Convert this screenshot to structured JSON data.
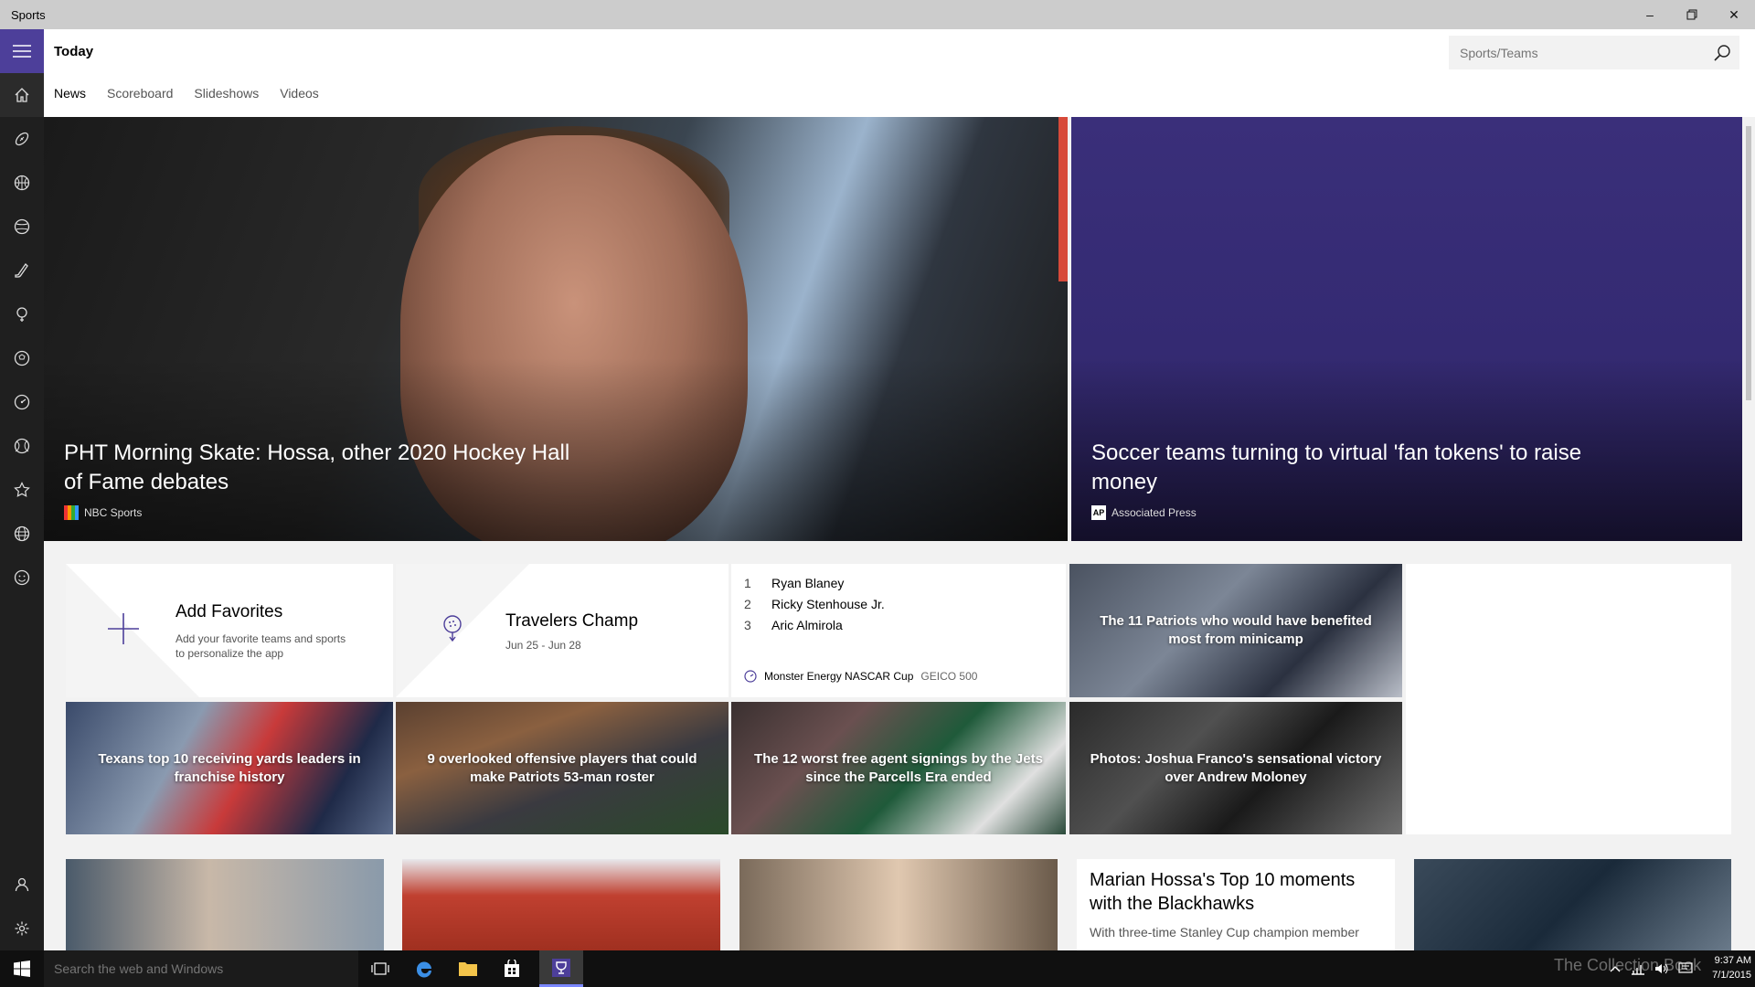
{
  "window": {
    "title": "Sports"
  },
  "header": {
    "title": "Today",
    "search": {
      "placeholder": "Sports/Teams",
      "value": ""
    },
    "tabs": [
      {
        "label": "News",
        "active": true
      },
      {
        "label": "Scoreboard",
        "active": false
      },
      {
        "label": "Slideshows",
        "active": false
      },
      {
        "label": "Videos",
        "active": false
      }
    ]
  },
  "rail": {
    "icons": [
      "hamburger-icon",
      "home-icon",
      "football-icon",
      "basketball-icon",
      "baseball-icon",
      "hockey-icon",
      "golf-icon",
      "soccer-icon",
      "racing-icon",
      "tennis-icon",
      "favorites-icon",
      "more-sports-icon",
      "fan-zone-icon",
      "account-icon",
      "settings-icon"
    ]
  },
  "heroes": [
    {
      "title": "PHT Morning Skate: Hossa, other 2020 Hockey Hall of Fame debates",
      "source": "NBC Sports",
      "logo": "NBC"
    },
    {
      "title": "Soccer teams turning to virtual 'fan tokens' to raise money",
      "source": "Associated Press",
      "logo": "AP"
    }
  ],
  "favorites": {
    "title": "Add Favorites",
    "subtitle": "Add your favorite teams and sports to personalize the app"
  },
  "tournament": {
    "title": "Travelers Champ",
    "dates": "Jun 25 - Jun 28"
  },
  "race": {
    "results": [
      {
        "pos": "1",
        "name": "Ryan Blaney"
      },
      {
        "pos": "2",
        "name": "Ricky Stenhouse Jr."
      },
      {
        "pos": "3",
        "name": "Aric Almirola"
      }
    ],
    "series": "Monster Energy NASCAR Cup",
    "event": "GEICO 500"
  },
  "tiles": [
    {
      "caption": "The 11 Patriots who would have benefited most from minicamp"
    },
    {
      "caption": "Texans top 10 receiving yards leaders in franchise history"
    },
    {
      "caption": "9 overlooked offensive players that could make Patriots 53-man roster"
    },
    {
      "caption": "The 12 worst free agent signings by the Jets since the Parcells Era ended"
    },
    {
      "caption": "Photos: Joshua Franco's sensational victory over Andrew Moloney"
    }
  ],
  "story": {
    "title": "Marian Hossa's Top 10 moments with the Blackhawks",
    "body": "With three-time Stanley Cup champion member"
  },
  "taskbar": {
    "search_placeholder": "Search the web and Windows",
    "watermark": "The Collection Book",
    "time": "9:37 AM",
    "date": "7/1/2015"
  },
  "colors": {
    "accent": "#4d3f9a",
    "rail": "#1f1f1f",
    "hero2": "#3a2f7a"
  }
}
